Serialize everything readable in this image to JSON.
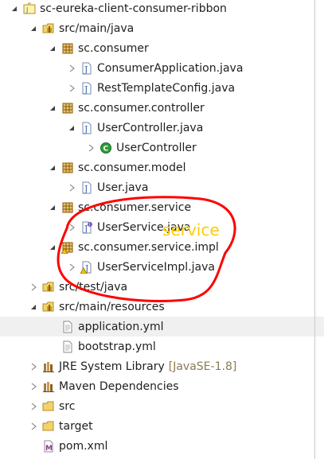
{
  "tree": [
    {
      "level": 0,
      "toggle": "expanded",
      "icon": "project-icon",
      "label": "sc-eureka-client-consumer-ribbon"
    },
    {
      "level": 1,
      "toggle": "expanded",
      "icon": "source-folder-icon",
      "label": "src/main/java"
    },
    {
      "level": 2,
      "toggle": "expanded",
      "icon": "package-icon",
      "label": "sc.consumer"
    },
    {
      "level": 3,
      "toggle": "collapsed",
      "icon": "java-file-icon",
      "label": "ConsumerApplication.java"
    },
    {
      "level": 3,
      "toggle": "collapsed",
      "icon": "java-file-icon",
      "label": "RestTemplateConfig.java"
    },
    {
      "level": 2,
      "toggle": "expanded",
      "icon": "package-icon",
      "label": "sc.consumer.controller"
    },
    {
      "level": 3,
      "toggle": "expanded",
      "icon": "java-file-icon",
      "label": "UserController.java"
    },
    {
      "level": 4,
      "toggle": "collapsed",
      "icon": "class-icon",
      "label": "UserController"
    },
    {
      "level": 2,
      "toggle": "expanded",
      "icon": "package-icon",
      "label": "sc.consumer.model"
    },
    {
      "level": 3,
      "toggle": "collapsed",
      "icon": "java-file-icon",
      "label": "User.java"
    },
    {
      "level": 2,
      "toggle": "expanded",
      "icon": "package-icon",
      "label": "sc.consumer.service"
    },
    {
      "level": 3,
      "toggle": "collapsed",
      "icon": "java-interface-file-icon",
      "label": "UserService.java"
    },
    {
      "level": 2,
      "toggle": "expanded",
      "icon": "package-warning-icon",
      "label": "sc.consumer.service.impl"
    },
    {
      "level": 3,
      "toggle": "collapsed",
      "icon": "java-file-warning-icon",
      "label": "UserServiceImpl.java"
    },
    {
      "level": 1,
      "toggle": "collapsed",
      "icon": "source-folder-icon",
      "label": "src/test/java"
    },
    {
      "level": 1,
      "toggle": "expanded",
      "icon": "source-folder-icon",
      "label": "src/main/resources"
    },
    {
      "level": 2,
      "toggle": "none",
      "icon": "file-icon",
      "label": "application.yml",
      "selected": true
    },
    {
      "level": 2,
      "toggle": "none",
      "icon": "file-icon",
      "label": "bootstrap.yml"
    },
    {
      "level": 1,
      "toggle": "collapsed",
      "icon": "library-icon",
      "label": "JRE System Library",
      "suffix": "[JavaSE-1.8]"
    },
    {
      "level": 1,
      "toggle": "collapsed",
      "icon": "library-icon",
      "label": "Maven Dependencies"
    },
    {
      "level": 1,
      "toggle": "collapsed",
      "icon": "folder-icon",
      "label": "src"
    },
    {
      "level": 1,
      "toggle": "collapsed",
      "icon": "folder-icon",
      "label": "target"
    },
    {
      "level": 1,
      "toggle": "none",
      "icon": "maven-pom-icon",
      "label": "pom.xml"
    }
  ],
  "annotation": {
    "text": "service",
    "color": "#ffcc00",
    "stroke_color": "#ff0000"
  }
}
